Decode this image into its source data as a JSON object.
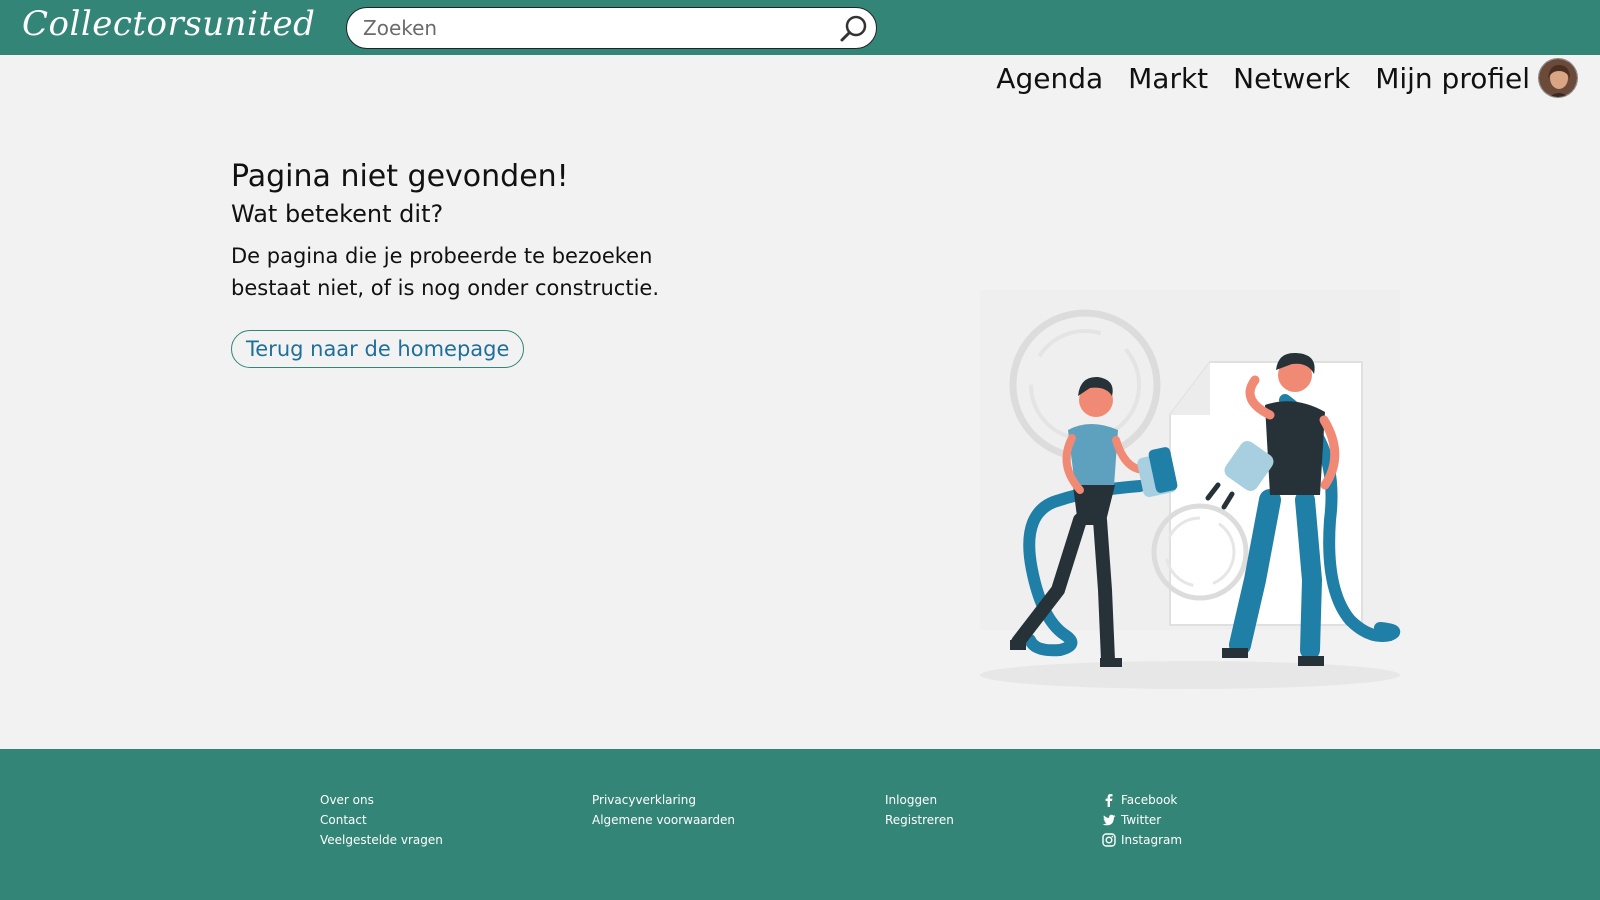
{
  "header": {
    "logo": "Collectorsunited",
    "search_placeholder": "Zoeken"
  },
  "nav": {
    "items": [
      "Agenda",
      "Markt",
      "Netwerk",
      "Mijn profiel"
    ]
  },
  "main": {
    "title": "Pagina niet gevonden!",
    "subtitle": "Wat betekent dit?",
    "description": "De pagina die je probeerde te bezoeken bestaat niet, of is nog onder constructie.",
    "button_label": "Terug naar de homepage"
  },
  "footer": {
    "col1": [
      "Over ons",
      "Contact",
      "Veelgestelde vragen"
    ],
    "col2": [
      "Privacyverklaring",
      "Algemene voorwaarden"
    ],
    "col3": [
      "Inloggen",
      "Registreren"
    ],
    "social": [
      {
        "label": "Facebook",
        "icon": "facebook-icon"
      },
      {
        "label": "Twitter",
        "icon": "twitter-icon"
      },
      {
        "label": "Instagram",
        "icon": "instagram-icon"
      }
    ]
  },
  "colors": {
    "brand": "#338677",
    "background": "#f2f2f2",
    "link": "#1f6f9a",
    "illustration_accent": "#1f7fa6"
  }
}
